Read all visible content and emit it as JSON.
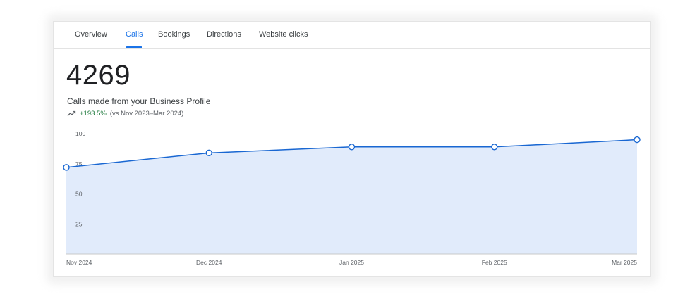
{
  "tabs": [
    {
      "label": "Overview"
    },
    {
      "label": "Calls",
      "active": true
    },
    {
      "label": "Bookings"
    },
    {
      "label": "Directions"
    },
    {
      "label": "Website clicks"
    }
  ],
  "metric": {
    "value": "4269",
    "description": "Calls made from your Business Profile",
    "change": "+193.5%",
    "comparison": "(vs Nov 2023–Mar 2024)",
    "trend_icon": "trending-up-icon"
  },
  "colors": {
    "accent": "#1a73e8",
    "line": "#1967d2",
    "area_fill": "#e1ebfb",
    "positive": "#137333"
  },
  "chart_data": {
    "type": "area",
    "categories": [
      "Nov 2024",
      "Dec 2024",
      "Jan 2025",
      "Feb 2025",
      "Mar 2025"
    ],
    "values": [
      72,
      84,
      89,
      89,
      95
    ],
    "yticks": [
      100,
      75,
      50,
      25
    ],
    "ylim": [
      0,
      100
    ],
    "grid": false,
    "title": "",
    "xlabel": "",
    "ylabel": ""
  }
}
